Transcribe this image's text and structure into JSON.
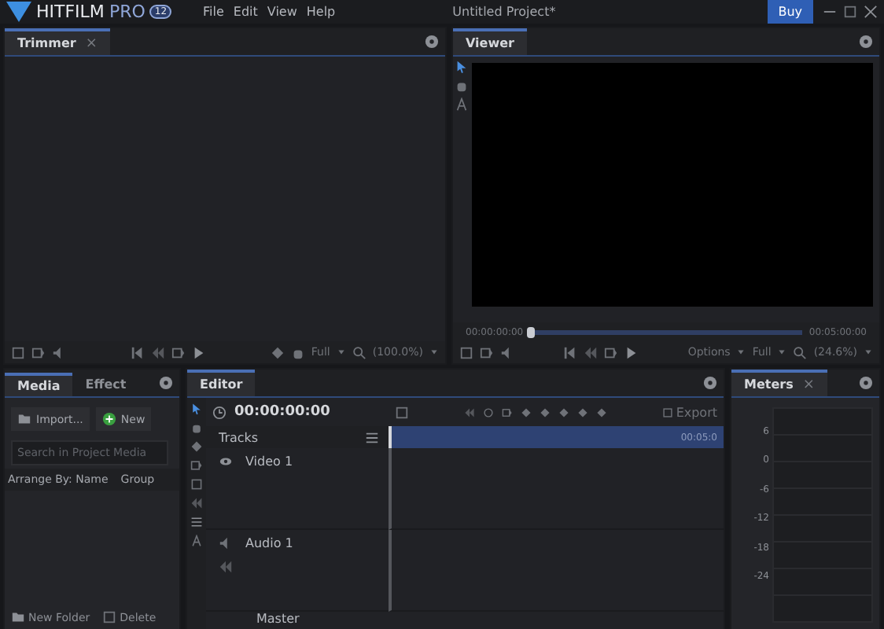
{
  "app": {
    "name": "HITFILM",
    "edition": "PRO",
    "version": "12"
  },
  "menu": [
    "File",
    "Edit",
    "View",
    "Help"
  ],
  "title": "Untitled Project*",
  "buy": "Buy",
  "trimmer": {
    "tab": "Trimmer",
    "close": "×",
    "full": "Full",
    "zoom": "(100.0%)"
  },
  "viewer": {
    "tab": "Viewer",
    "time_start": "00:00:00:00",
    "time_end": "00:05:00:00",
    "level": 0,
    "options": "Options",
    "full": "Full",
    "zoom": "(24.6%)"
  },
  "media_tabs": [
    {
      "label": "Media",
      "selected": true
    },
    {
      "label": "Effect",
      "selected": false
    }
  ],
  "media": {
    "import": "Import...",
    "new": "New",
    "search_placeholder": "Search in Project Media",
    "arrange": "Arrange By: Name",
    "group": "Group",
    "new_folder": "New Folder",
    "delete": "Delete"
  },
  "editor": {
    "tab": "Editor",
    "time": "00:00:00:00",
    "tracks_label": "Tracks",
    "export": "Export",
    "ruler_end": "00:05:0",
    "tracks": [
      {
        "name": "Video 1",
        "kind": "video"
      },
      {
        "name": "Audio 1",
        "kind": "audio"
      }
    ],
    "master": "Master"
  },
  "meters": {
    "tab": "Meters",
    "close": "×",
    "scale": [
      "6",
      "0",
      "-6",
      "-12",
      "-18",
      "-24"
    ]
  }
}
